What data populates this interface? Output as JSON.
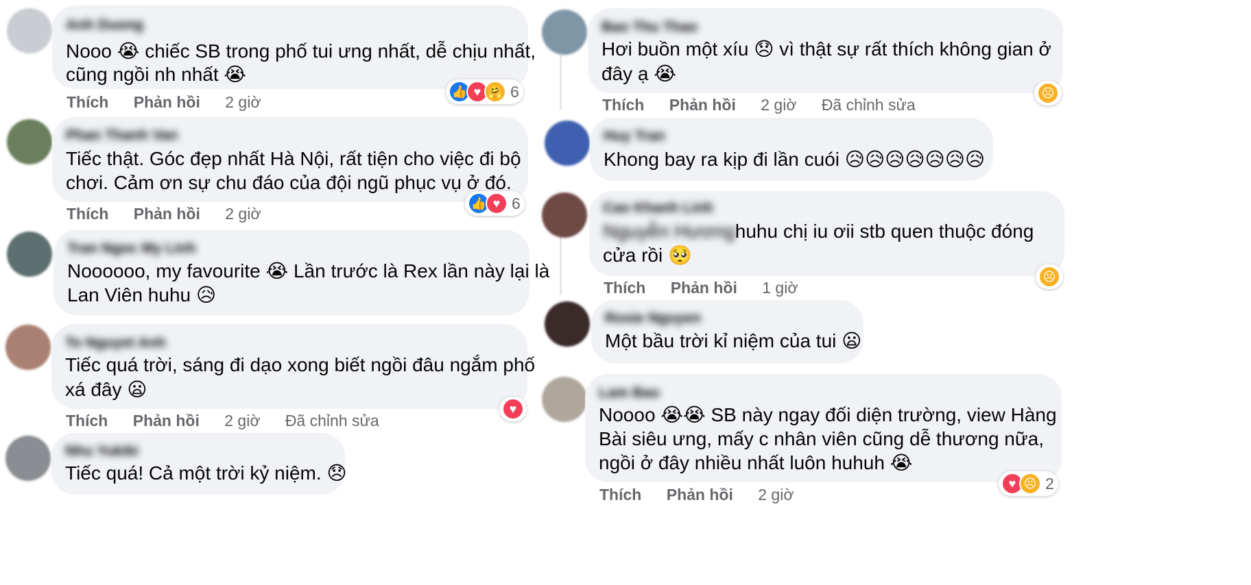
{
  "colors": {
    "bubble": "#f0f2f5",
    "meta": "#65676b",
    "like": "#1877f2",
    "love": "#f33e58",
    "emoji": "#f7b125"
  },
  "labels": {
    "like": "Thích",
    "reply": "Phản hồi",
    "edited": "Đã chỉnh sửa"
  },
  "left_comments": [
    {
      "author": "Anh Duong",
      "lines": [
        "Nooo 😭 chiếc SB trong phố tui ưng nhất, dễ chịu nhất,",
        "cũng ngồi nh nhất 😭"
      ],
      "time": "2 giờ",
      "reaction_count": "6",
      "reaction_icons": [
        "like-icon",
        "love-icon",
        "care-icon"
      ]
    },
    {
      "author": "Phan Thanh Van",
      "lines": [
        "Tiếc thật. Góc đẹp nhất Hà Nội, rất tiện cho việc đi bộ",
        "chơi. Cảm ơn sự chu đáo của đội ngũ phục vụ ở đó."
      ],
      "time": "2 giờ",
      "reaction_count": "6",
      "reaction_icons": [
        "like-icon",
        "love-icon"
      ]
    },
    {
      "author": "Tran Ngoc My Linh",
      "lines": [
        "Noooooo, my favourite 😭 Lần trước là Rex lần này lại là",
        "Lan Viên huhu 😥"
      ]
    },
    {
      "author": "To Nguyet Anh",
      "lines": [
        "Tiếc quá trời, sáng đi dạo xong biết ngồi đâu ngắm phố",
        "xá đây 😦"
      ],
      "time": "2 giờ",
      "edited": true,
      "reaction_icons": [
        "love-icon"
      ]
    },
    {
      "author": "Nhu Yukiki",
      "lines": [
        "Tiếc quá! Cả một trời kỷ niệm. 😞"
      ]
    }
  ],
  "right_comments": [
    {
      "author": "Bao Thu Thao",
      "lines": [
        "Hơi buồn một xíu 😞 vì thật sự rất thích không gian ở",
        "đây ạ 😭"
      ],
      "time": "2 giờ",
      "edited": true,
      "reaction_icons": [
        "sad-icon"
      ]
    },
    {
      "author": "Huy Tran",
      "lines": [
        "Khong bay ra kịp đi lần cuói 😥😥😥😥😥😥😥"
      ]
    },
    {
      "author": "Cao Khanh Linh",
      "mention": "Nguyễn Hương",
      "lines": [
        "huhu chị iu ơii stb quen thuộc đóng",
        "cửa rồi 🥺"
      ],
      "time": "1 giờ",
      "reaction_icons": [
        "sad-icon"
      ]
    },
    {
      "author": "Rosie Nguyen",
      "lines": [
        "Một bầu trời kỉ niệm của tui 😦"
      ]
    },
    {
      "author": "Lam Bao",
      "lines": [
        "Noooo 😭😭 SB này ngay đối diện trường, view Hàng",
        "Bài siêu ưng, mấy c nhân viên cũng dễ thương nữa,",
        "ngồi ở đây nhiều nhất luôn huhuh 😭"
      ],
      "time": "2 giờ",
      "reaction_count": "2",
      "reaction_icons": [
        "love-icon",
        "sad-icon"
      ]
    }
  ]
}
